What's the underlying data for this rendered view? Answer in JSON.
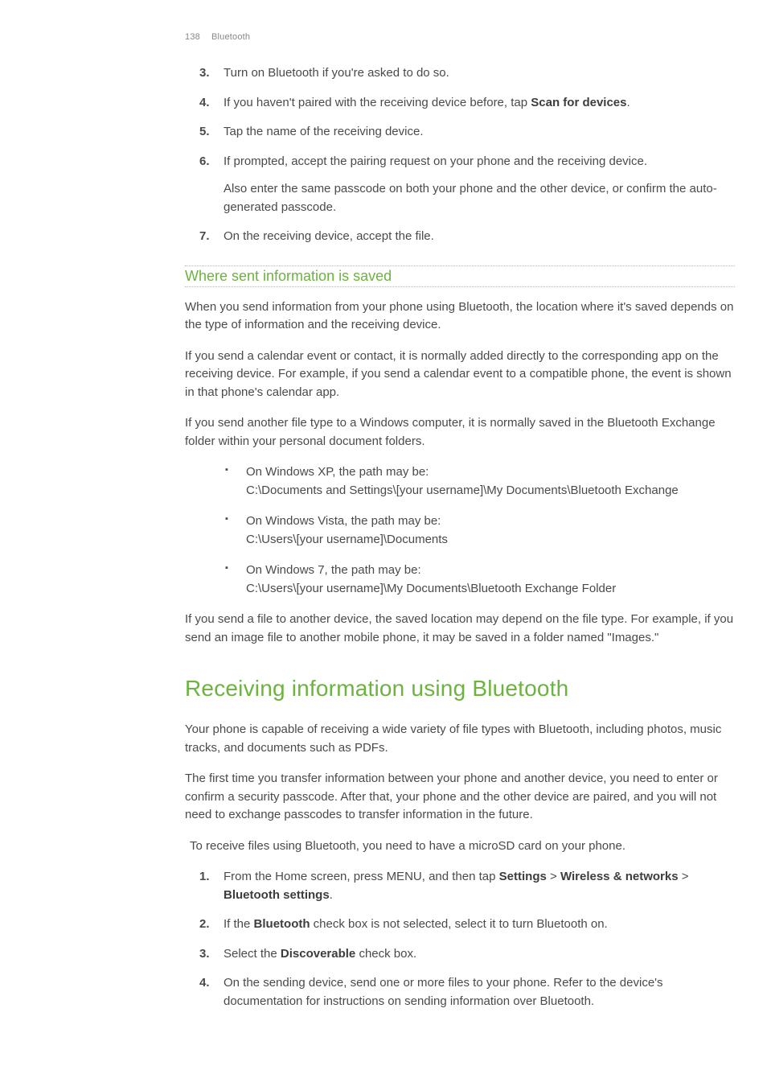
{
  "header": {
    "page_number": "138",
    "section": "Bluetooth"
  },
  "steps_top": [
    {
      "n": "3.",
      "text": "Turn on Bluetooth if you're asked to do so."
    },
    {
      "n": "4.",
      "prefix": "If you haven't paired with the receiving device before, tap ",
      "bold": "Scan for devices",
      "suffix": "."
    },
    {
      "n": "5.",
      "text": "Tap the name of the receiving device."
    },
    {
      "n": "6.",
      "text": "If prompted, accept the pairing request on your phone and the receiving device.",
      "extra": "Also enter the same passcode on both your phone and the other device, or confirm the auto-generated passcode."
    },
    {
      "n": "7.",
      "text": "On the receiving device, accept the file."
    }
  ],
  "subhead1": "Where sent information is saved",
  "para1": "When you send information from your phone using Bluetooth, the location where it's saved depends on the type of information and the receiving device.",
  "para2": "If you send a calendar event or contact, it is normally added directly to the corresponding app on the receiving device. For example, if you send a calendar event to a compatible phone, the event is shown in that phone's calendar app.",
  "para3": "If you send another file type to a Windows computer, it is normally saved in the Bluetooth Exchange folder within your personal document folders.",
  "bullets": [
    {
      "head": "On Windows XP, the path may be:",
      "path": "C:\\Documents and Settings\\[your username]\\My Documents\\Bluetooth Exchange"
    },
    {
      "head": "On Windows Vista, the path may be:",
      "path": "C:\\Users\\[your username]\\Documents"
    },
    {
      "head": "On Windows 7, the path may be:",
      "path": "C:\\Users\\[your username]\\My Documents\\Bluetooth Exchange Folder"
    }
  ],
  "para4": "If you send a file to another device, the saved location may depend on the file type. For example, if you send an image file to another mobile phone, it may be saved in a folder named \"Images.\"",
  "section_head": "Receiving information using Bluetooth",
  "para5": "Your phone is capable of receiving a wide variety of file types with Bluetooth, including photos, music tracks, and documents such as PDFs.",
  "para6": "The first time you transfer information between your phone and another device, you need to enter or confirm a security passcode. After that, your phone and the other device are paired, and you will not need to exchange passcodes to transfer information in the future.",
  "note": "To receive files using Bluetooth, you need to have a microSD card on your phone.",
  "steps_bottom": [
    {
      "n": "1.",
      "segments": [
        {
          "t": "From the Home screen, press MENU, and then tap "
        },
        {
          "t": "Settings",
          "b": true
        },
        {
          "t": " > "
        },
        {
          "t": "Wireless & networks",
          "b": true
        },
        {
          "t": " > "
        },
        {
          "t": "Bluetooth settings",
          "b": true
        },
        {
          "t": "."
        }
      ]
    },
    {
      "n": "2.",
      "segments": [
        {
          "t": "If the "
        },
        {
          "t": "Bluetooth",
          "b": true
        },
        {
          "t": " check box is not selected, select it to turn Bluetooth on."
        }
      ]
    },
    {
      "n": "3.",
      "segments": [
        {
          "t": "Select the "
        },
        {
          "t": "Discoverable",
          "b": true
        },
        {
          "t": " check box."
        }
      ]
    },
    {
      "n": "4.",
      "segments": [
        {
          "t": "On the sending device, send one or more files to your phone. Refer to the device's documentation for instructions on sending information over Bluetooth."
        }
      ]
    }
  ]
}
